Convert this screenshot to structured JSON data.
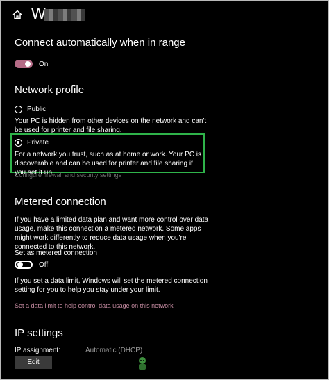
{
  "header": {
    "title": "W"
  },
  "connect_auto": {
    "heading": "Connect automatically when in range",
    "toggle_state": "On"
  },
  "network_profile": {
    "heading": "Network profile",
    "public": {
      "label": "Public",
      "description": "Your PC is hidden from other devices on the network and can't be used for printer and file sharing.",
      "selected": false
    },
    "private": {
      "label": "Private",
      "description": "For a network you trust, such as at home or work. Your PC is discoverable and can be used for printer and file sharing if you set it up.",
      "selected": true
    },
    "firewall_link": "Configure firewall and security settings"
  },
  "metered": {
    "heading": "Metered connection",
    "description": "If you have a limited data plan and want more control over data usage, make this connection a metered network. Some apps might work differently to reduce data usage when you're connected to this network.",
    "toggle_label": "Set as metered connection",
    "toggle_state": "Off",
    "limit_description": "If you set a data limit, Windows will set the metered connection setting for you to help you stay under your limit.",
    "limit_link": "Set a data limit to help control data usage on this network"
  },
  "ip_settings": {
    "heading": "IP settings",
    "assignment_label": "IP assignment:",
    "assignment_value": "Automatic (DHCP)",
    "edit_label": "Edit"
  },
  "colors": {
    "background": "#000000",
    "accent": "#b56b86",
    "highlight": "#2fb34a"
  }
}
